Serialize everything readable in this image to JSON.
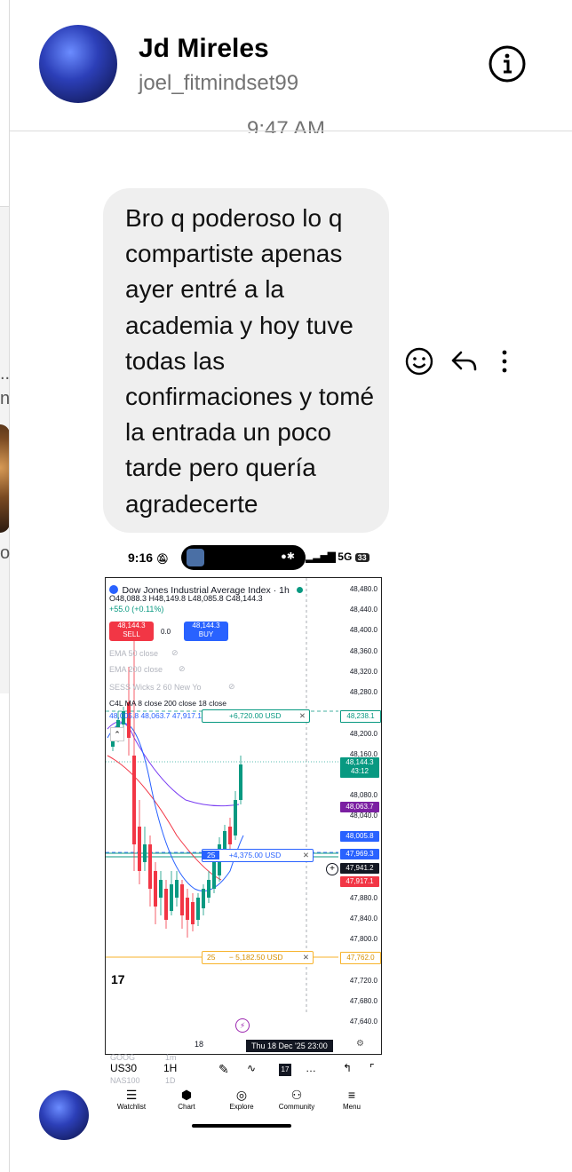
{
  "header": {
    "name": "Jd Mireles",
    "handle": "joel_fitmindset99",
    "timestamp": "9:47 AM"
  },
  "left_fragments": {
    "dots": "..",
    "letter_n": "n",
    "letter_o": "o"
  },
  "message": {
    "text": "Bro q poderoso lo q compartiste apenas ayer entré a la academia y hoy tuve todas las confirmaciones y tomé la entrada un poco tarde pero quería agradecerte"
  },
  "message_actions": {
    "react_icon": "smiley-icon",
    "reply_icon": "reply-icon",
    "more_icon": "more-vertical-icon"
  },
  "screenshot": {
    "status_time": "9:16",
    "status_right": "5G",
    "battery": "33",
    "chart_title": "Dow Jones Industrial Average Index · 1h",
    "ohlc": "O48,088.3 H48,149.8 L48,085.8 C48,144.3",
    "change": "+55.0 (+0.11%)",
    "sell_price": "48,144.3",
    "sell_label": "SELL",
    "spread": "0.0",
    "buy_price": "48,144.3",
    "buy_label": "BUY",
    "ind1": "EMA 50 close",
    "ind2": "EMA 200 close",
    "ind3": "SESS   Wicks 2 60 New Yo",
    "ind4": "C4L MA 8 close 200 close 18 close",
    "ind5": "48,005.8  48,063.7  47,917.1",
    "pos1_pnl": "+6,720.00 USD",
    "pos2_qty": "25",
    "pos2_pnl": "+4,375.00 USD",
    "pos3_qty": "25",
    "pos3_pnl": "− 5,182.50 USD",
    "price_labels": [
      "48,480.0",
      "48,440.0",
      "48,400.0",
      "48,360.0",
      "48,320.0",
      "48,280.0",
      "48,200.0",
      "48,160.0",
      "48,080.0",
      "48,040.0",
      "47,880.0",
      "47,840.0",
      "47,800.0",
      "47,720.0",
      "47,680.0",
      "47,640.0"
    ],
    "tag_238": "48,238.1",
    "tag_current": "48,144.3",
    "tag_countdown": "43:12",
    "tag_063": "48,063.7",
    "tag_005": "48,005.8",
    "tag_969": "47,969.3",
    "tag_941": "47,941.2",
    "tag_917": "47,917.1",
    "tag_762": "47,762.0",
    "x_label": "18",
    "date_label": "Thu 18 Dec '25  23:00",
    "ticker": "US30",
    "interval": "1H",
    "faded_ticker1": "GOOG",
    "faded_ticker2": "NAS100",
    "faded_int1": "1m",
    "faded_int2": "1D",
    "nav": [
      "Watchlist",
      "Chart",
      "Explore",
      "Community",
      "Menu"
    ]
  }
}
